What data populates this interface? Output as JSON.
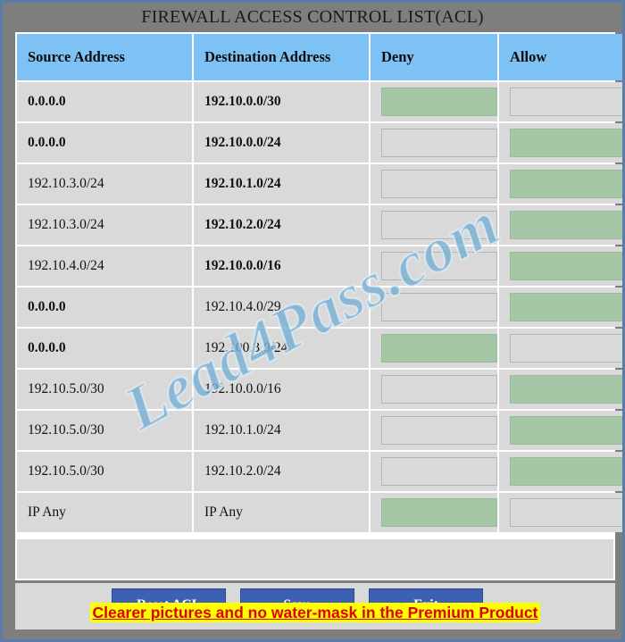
{
  "window": {
    "title": "FIREWALL ACCESS CONTROL LIST(ACL)",
    "frame_color": "#7e7e7e",
    "border_color": "#5b7ca8"
  },
  "table": {
    "headers": {
      "source": "Source Address",
      "destination": "Destination Address",
      "deny": "Deny",
      "allow": "Allow"
    },
    "header_bg": "#7ec2f5",
    "row_bg": "#d9d9d9",
    "checked_color": "#a6c7a6",
    "rows": [
      {
        "source": "0.0.0.0",
        "destination": "192.10.0.0/30",
        "source_bold": true,
        "destination_bold": true,
        "deny": true,
        "allow": false
      },
      {
        "source": "0.0.0.0",
        "destination": "192.10.0.0/24",
        "source_bold": true,
        "destination_bold": true,
        "deny": false,
        "allow": true
      },
      {
        "source": "192.10.3.0/24",
        "destination": "192.10.1.0/24",
        "source_bold": false,
        "destination_bold": true,
        "deny": false,
        "allow": true
      },
      {
        "source": "192.10.3.0/24",
        "destination": "192.10.2.0/24",
        "source_bold": false,
        "destination_bold": true,
        "deny": false,
        "allow": true
      },
      {
        "source": "192.10.4.0/24",
        "destination": "192.10.0.0/16",
        "source_bold": false,
        "destination_bold": true,
        "deny": false,
        "allow": true
      },
      {
        "source": "0.0.0.0",
        "destination": "192.10.4.0/29",
        "source_bold": true,
        "destination_bold": false,
        "deny": false,
        "allow": true
      },
      {
        "source": "0.0.0.0",
        "destination": "192.100.3.0/24",
        "source_bold": true,
        "destination_bold": false,
        "deny": true,
        "allow": false
      },
      {
        "source": "192.10.5.0/30",
        "destination": "192.10.0.0/16",
        "source_bold": false,
        "destination_bold": false,
        "deny": false,
        "allow": true
      },
      {
        "source": "192.10.5.0/30",
        "destination": "192.10.1.0/24",
        "source_bold": false,
        "destination_bold": false,
        "deny": false,
        "allow": true
      },
      {
        "source": "192.10.5.0/30",
        "destination": "192.10.2.0/24",
        "source_bold": false,
        "destination_bold": false,
        "deny": false,
        "allow": true
      },
      {
        "source": "IP Any",
        "destination": "IP Any",
        "source_bold": false,
        "destination_bold": false,
        "deny": true,
        "allow": false
      }
    ]
  },
  "buttons": {
    "reset": "Reset ACL",
    "save": "Save",
    "exit": "Exit",
    "color": "#3b60b4"
  },
  "watermarks": {
    "diagonal": "Lead4Pass.com",
    "banner": "Clearer pictures and no water-mask in the Premium Product",
    "banner_bg": "#ffff00",
    "banner_color": "#e00000"
  }
}
